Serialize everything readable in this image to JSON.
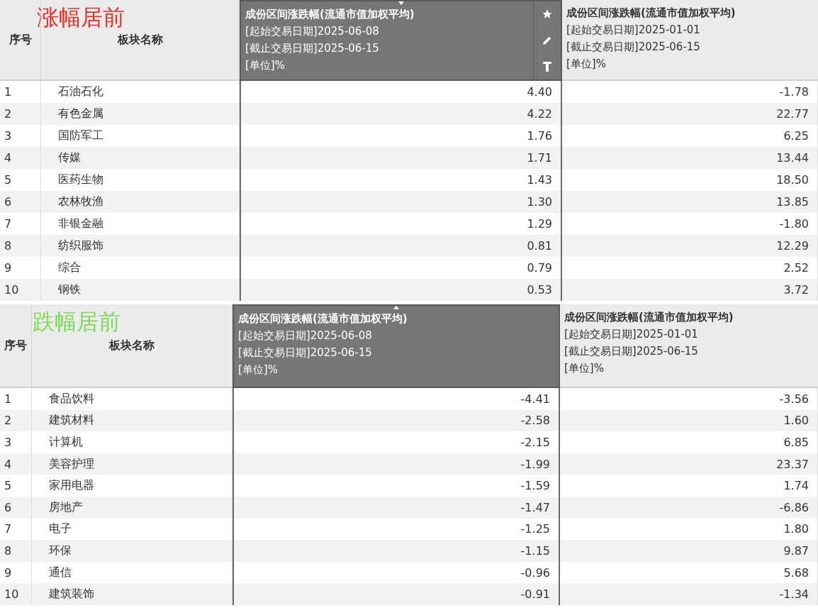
{
  "tables": [
    {
      "title": "涨幅居前",
      "color": "#e8332a",
      "index_header": "序号",
      "name_header": "板块名称",
      "show_tools": true,
      "columns": [
        {
          "title": "成份区间涨跌幅(流通市值加权平均)",
          "start": "[起始交易日期]2025-06-08",
          "end": "[截止交易日期]2025-06-15",
          "unit": "[单位]%",
          "selected": true,
          "sort_descending": true
        },
        {
          "title": "成份区间涨跌幅(流通市值加权平均)",
          "start": "[起始交易日期]2025-01-01",
          "end": "[截止交易日期]2025-06-15",
          "unit": "[单位]%",
          "selected": false
        }
      ],
      "rows": [
        {
          "index": "1",
          "name": "石油石化",
          "values": [
            "4.40",
            "-1.78"
          ]
        },
        {
          "index": "2",
          "name": "有色金属",
          "values": [
            "4.22",
            "22.77"
          ]
        },
        {
          "index": "3",
          "name": "国防军工",
          "values": [
            "1.76",
            "6.25"
          ]
        },
        {
          "index": "4",
          "name": "传媒",
          "values": [
            "1.71",
            "13.44"
          ]
        },
        {
          "index": "5",
          "name": "医药生物",
          "values": [
            "1.43",
            "18.50"
          ]
        },
        {
          "index": "6",
          "name": "农林牧渔",
          "values": [
            "1.30",
            "13.85"
          ]
        },
        {
          "index": "7",
          "name": "非银金融",
          "values": [
            "1.29",
            "-1.80"
          ]
        },
        {
          "index": "8",
          "name": "纺织服饰",
          "values": [
            "0.81",
            "12.29"
          ]
        },
        {
          "index": "9",
          "name": "综合",
          "values": [
            "0.79",
            "2.52"
          ]
        },
        {
          "index": "10",
          "name": "钢铁",
          "values": [
            "0.53",
            "3.72"
          ]
        }
      ]
    },
    {
      "title": "跌幅居前",
      "color": "#7ed957",
      "index_header": "序号",
      "name_header": "板块名称",
      "show_tools": false,
      "columns": [
        {
          "title": "成份区间涨跌幅(流通市值加权平均)",
          "start": "[起始交易日期]2025-06-08",
          "end": "[截止交易日期]2025-06-15",
          "unit": "[单位]%",
          "selected": true,
          "sort_descending": false
        },
        {
          "title": "成份区间涨跌幅(流通市值加权平均)",
          "start": "[起始交易日期]2025-01-01",
          "end": "[截止交易日期]2025-06-15",
          "unit": "[单位]%",
          "selected": false
        }
      ],
      "rows": [
        {
          "index": "1",
          "name": "食品饮料",
          "values": [
            "-4.41",
            "-3.56"
          ]
        },
        {
          "index": "2",
          "name": "建筑材料",
          "values": [
            "-2.58",
            "1.60"
          ]
        },
        {
          "index": "3",
          "name": "计算机",
          "values": [
            "-2.15",
            "6.85"
          ]
        },
        {
          "index": "4",
          "name": "美容护理",
          "values": [
            "-1.99",
            "23.37"
          ]
        },
        {
          "index": "5",
          "name": "家用电器",
          "values": [
            "-1.59",
            "1.74"
          ]
        },
        {
          "index": "6",
          "name": "房地产",
          "values": [
            "-1.47",
            "-6.86"
          ]
        },
        {
          "index": "7",
          "name": "电子",
          "values": [
            "-1.25",
            "1.80"
          ]
        },
        {
          "index": "8",
          "name": "环保",
          "values": [
            "-1.15",
            "9.87"
          ]
        },
        {
          "index": "9",
          "name": "通信",
          "values": [
            "-0.96",
            "5.68"
          ]
        },
        {
          "index": "10",
          "name": "建筑装饰",
          "values": [
            "-0.91",
            "-1.34"
          ]
        }
      ]
    }
  ]
}
